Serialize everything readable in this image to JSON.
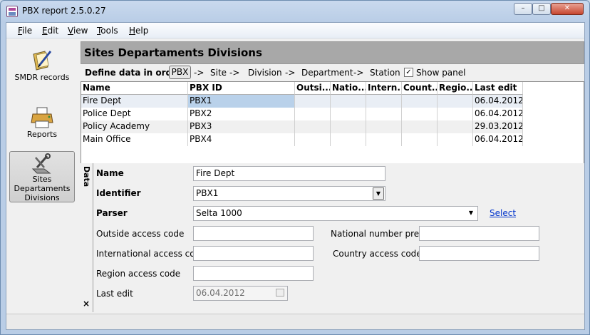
{
  "window": {
    "title": "PBX report 2.5.0.27",
    "min_glyph": "–",
    "max_glyph": "□",
    "close_glyph": "✕"
  },
  "menu": [
    "File",
    "Edit",
    "View",
    "Tools",
    "Help"
  ],
  "nav": [
    {
      "label": "SMDR records",
      "icon": "book-pen-icon"
    },
    {
      "label": "Reports",
      "icon": "printer-icon"
    },
    {
      "label": "Sites Departaments Divisions",
      "icon": "tools-icon",
      "selected": true
    }
  ],
  "header": {
    "title": "Sites Departaments Divisions"
  },
  "breadcrumb": {
    "prefix": "Define data in order",
    "items": [
      "PBX",
      "Site",
      "Division",
      "Department",
      "Station"
    ],
    "arrow": "->",
    "show_panel_label": "Show panel",
    "show_panel_checked": true,
    "check_glyph": "✓"
  },
  "grid": {
    "columns": [
      "Name",
      "PBX ID",
      "Outsi...",
      "Natio...",
      "Intern...",
      "Count...",
      "Regio...",
      "Last edit"
    ],
    "rows": [
      [
        "Fire Dept",
        "PBX1",
        "",
        "",
        "",
        "",
        "",
        "06.04.2012"
      ],
      [
        "Police Dept",
        "PBX2",
        "",
        "",
        "",
        "",
        "",
        "06.04.2012"
      ],
      [
        "Policy Academy",
        "PBX3",
        "",
        "",
        "",
        "",
        "",
        "29.03.2012"
      ],
      [
        "Main Office",
        "PBX4",
        "",
        "",
        "",
        "",
        "",
        "06.04.2012"
      ]
    ],
    "selected_row": 0
  },
  "navigator": [
    "⏮",
    "◀◀",
    "◀",
    "▶",
    "▶▶",
    "⏭",
    "+",
    "+",
    "−",
    "▲",
    "✓",
    "↻",
    "▽"
  ],
  "scroll": {
    "left_glyph": "‹",
    "right_glyph": "›"
  },
  "form": {
    "panel_label": "Data",
    "close_glyph": "×",
    "name_label": "Name",
    "name_value": "Fire Dept",
    "identifier_label": "Identifier",
    "identifier_value": "PBX1",
    "parser_label": "Parser",
    "parser_value": "Selta 1000",
    "select_link": "Select",
    "outside_label": "Outside access code",
    "outside_value": "",
    "national_label": "National number prefix",
    "national_value": "",
    "international_label": "International access code",
    "international_value": "",
    "country_label": "Country access code",
    "country_value": "",
    "region_label": "Region access code",
    "region_value": "",
    "last_edit_label": "Last edit",
    "last_edit_value": "06.04.2012",
    "dropdown_glyph": "▼"
  }
}
